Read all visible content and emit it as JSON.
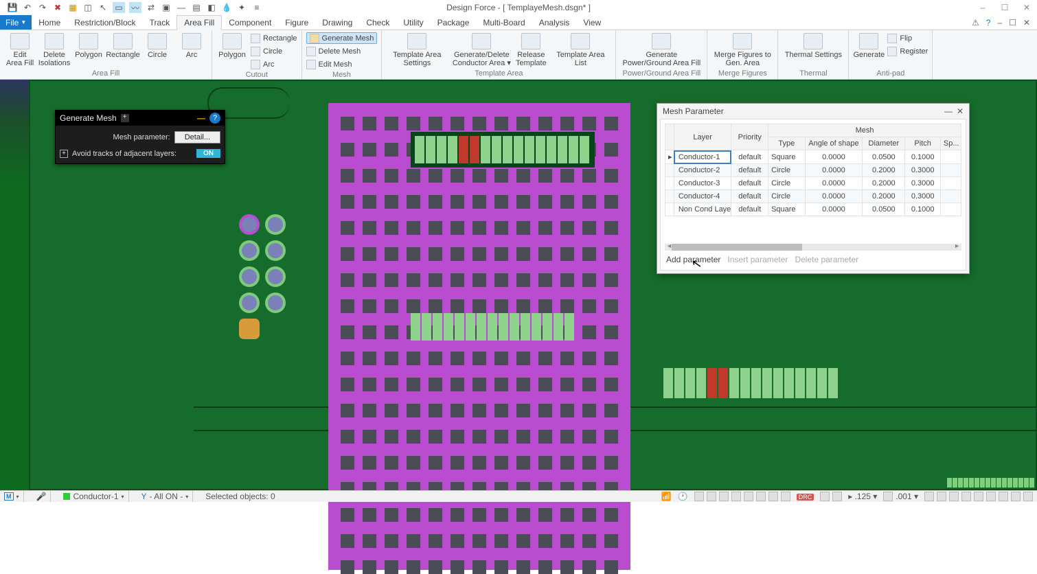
{
  "app": {
    "title": "Design Force - [ TemplayeMesh.dsgn* ]",
    "window_buttons": {
      "min": "–",
      "max": "☐",
      "close": "✕"
    }
  },
  "qat_icons": [
    "save",
    "undo",
    "redo",
    "delete",
    "copy",
    "grid",
    "select-mode",
    "select-rect",
    "select-lasso",
    "swap",
    "annotate",
    "toggle",
    "layers",
    "fill-mode",
    "flip",
    "sparkle",
    "overflow"
  ],
  "menus": {
    "file": "File",
    "items": [
      "Home",
      "Restriction/Block",
      "Track",
      "Area Fill",
      "Component",
      "Figure",
      "Drawing",
      "Check",
      "Utility",
      "Package",
      "Multi-Board",
      "Analysis",
      "View"
    ],
    "active": "Area Fill",
    "right_icons": [
      "warning",
      "help",
      "min",
      "restore",
      "close"
    ]
  },
  "ribbon": {
    "groups": [
      {
        "label": "Area Fill",
        "big": [
          {
            "name": "edit-area-fill",
            "label": "Edit\nArea Fill"
          },
          {
            "name": "delete-isolations",
            "label": "Delete\nIsolations"
          }
        ]
      },
      {
        "label": "",
        "big": [
          {
            "name": "polygon",
            "label": "Polygon"
          },
          {
            "name": "rectangle",
            "label": "Rectangle"
          },
          {
            "name": "circle",
            "label": "Circle"
          },
          {
            "name": "arc",
            "label": "Arc"
          }
        ]
      },
      {
        "label": "Cutout",
        "big": [
          {
            "name": "cut-polygon",
            "label": "Polygon"
          }
        ],
        "mini": [
          {
            "name": "cut-rectangle",
            "label": "Rectangle"
          },
          {
            "name": "cut-circle",
            "label": "Circle"
          },
          {
            "name": "cut-arc",
            "label": "Arc"
          }
        ]
      },
      {
        "label": "Mesh",
        "mini_hl": [
          {
            "name": "generate-mesh",
            "label": "Generate Mesh",
            "highlight": true
          },
          {
            "name": "delete-mesh",
            "label": "Delete Mesh"
          },
          {
            "name": "edit-mesh",
            "label": "Edit Mesh"
          }
        ]
      },
      {
        "label": "Template Area",
        "big": [
          {
            "name": "template-area-settings",
            "label": "Template Area\nSettings",
            "wide": true
          },
          {
            "name": "gen-del-conductor-area",
            "label": "Generate/Delete\nConductor Area ▾",
            "wide": true
          },
          {
            "name": "release-template",
            "label": "Release\nTemplate"
          },
          {
            "name": "template-area-list",
            "label": "Template Area\nList",
            "wide": true
          }
        ]
      },
      {
        "label": "Power/Ground Area Fill",
        "big": [
          {
            "name": "gen-pg-area-fill",
            "label": "Generate\nPower/Ground Area Fill",
            "wide": true
          }
        ]
      },
      {
        "label": "Merge Figures",
        "big": [
          {
            "name": "merge-figures",
            "label": "Merge Figures to\nGen. Area",
            "wide": true
          }
        ]
      },
      {
        "label": "Thermal",
        "big": [
          {
            "name": "thermal-settings",
            "label": "Thermal Settings",
            "wide": true
          }
        ]
      },
      {
        "label": "Anti-pad",
        "big": [
          {
            "name": "generate-antipad",
            "label": "Generate"
          }
        ],
        "mini": [
          {
            "name": "flip",
            "label": "Flip"
          },
          {
            "name": "register",
            "label": "Register"
          }
        ]
      }
    ]
  },
  "gen_mesh_panel": {
    "title": "Generate Mesh",
    "row1_label": "Mesh parameter:",
    "row1_button": "Detail...",
    "row2_label": "Avoid tracks of adjacent layers:",
    "row2_button": "ON"
  },
  "mesh_param_dialog": {
    "title": "Mesh Parameter",
    "group_header": "Mesh",
    "columns": [
      "Layer",
      "Priority",
      "Type",
      "Angle of shape",
      "Diameter",
      "Pitch",
      "Sp..."
    ],
    "rows": [
      {
        "layer": "Conductor-1",
        "priority": "default",
        "type": "Square",
        "angle": "0.0000",
        "diameter": "0.0500",
        "pitch": "0.1000"
      },
      {
        "layer": "Conductor-2",
        "priority": "default",
        "type": "Circle",
        "angle": "0.0000",
        "diameter": "0.2000",
        "pitch": "0.3000"
      },
      {
        "layer": "Conductor-3",
        "priority": "default",
        "type": "Circle",
        "angle": "0.0000",
        "diameter": "0.2000",
        "pitch": "0.3000"
      },
      {
        "layer": "Conductor-4",
        "priority": "default",
        "type": "Circle",
        "angle": "0.0000",
        "diameter": "0.2000",
        "pitch": "0.3000"
      },
      {
        "layer": "Non Cond Layer",
        "priority": "default",
        "type": "Square",
        "angle": "0.0000",
        "diameter": "0.0500",
        "pitch": "0.1000"
      }
    ],
    "footer": {
      "add": "Add parameter",
      "insert": "Insert parameter",
      "delete": "Delete parameter"
    }
  },
  "statusbar": {
    "layer": "Conductor-1",
    "filter": "- All ON -",
    "selected": "Selected objects: 0",
    "coord1": ".125",
    "coord2": ".001",
    "drc": "DRC"
  }
}
